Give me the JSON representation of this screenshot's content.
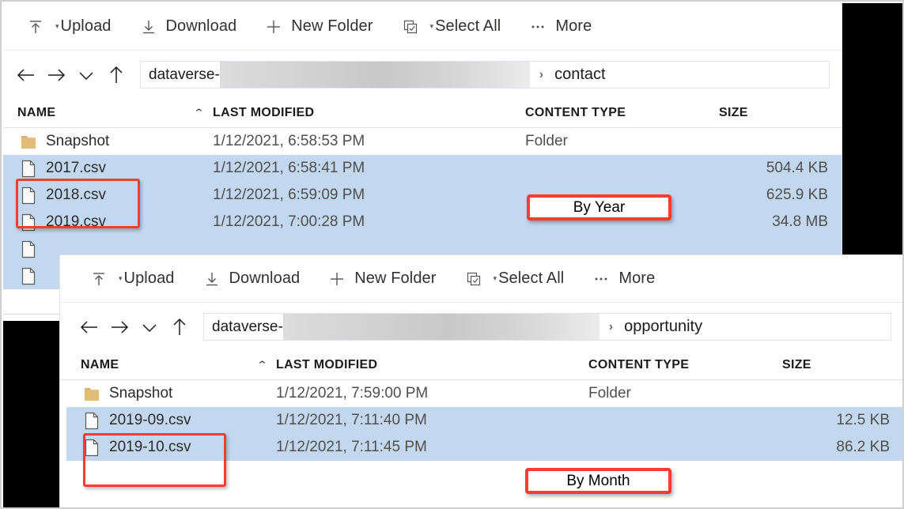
{
  "windows": [
    {
      "id": "contact",
      "toolbar": [
        {
          "label": "Upload",
          "icon": "upload-icon",
          "has_caret": true
        },
        {
          "label": "Download",
          "icon": "download-icon",
          "has_caret": false
        },
        {
          "label": "New Folder",
          "icon": "plus-icon",
          "has_caret": false
        },
        {
          "label": "Select All",
          "icon": "select-all-icon",
          "has_caret": true
        },
        {
          "label": "More",
          "icon": "ellipsis-icon",
          "has_caret": false
        }
      ],
      "nav": {
        "back_icon": "arrow-left-icon",
        "forward_icon": "arrow-right-icon",
        "history_icon": "chevron-down-icon",
        "up_icon": "arrow-up-icon"
      },
      "path": {
        "prefix": "dataverse-",
        "redacted": true,
        "separator": "›",
        "leaf": "contact"
      },
      "columns": [
        {
          "label": "NAME",
          "sorted": true,
          "sort_caret": "⌃"
        },
        {
          "label": "LAST MODIFIED",
          "sorted": false
        },
        {
          "label": "CONTENT TYPE",
          "sorted": false
        },
        {
          "label": "SIZE",
          "sorted": false
        }
      ],
      "rows": [
        {
          "name": "Snapshot",
          "icon": "folder-icon",
          "modified": "1/12/2021, 6:58:53 PM",
          "type": "Folder",
          "size": "",
          "selected": false
        },
        {
          "name": "2017.csv",
          "icon": "file-icon",
          "modified": "1/12/2021, 6:58:41 PM",
          "type": "",
          "size": "504.4 KB",
          "selected": true
        },
        {
          "name": "2018.csv",
          "icon": "file-icon",
          "modified": "1/12/2021, 6:59:09 PM",
          "type": "",
          "size": "625.9 KB",
          "selected": true
        },
        {
          "name": "2019.csv",
          "icon": "file-icon",
          "modified": "1/12/2021, 7:00:28 PM",
          "type": "",
          "size": "34.8 MB",
          "selected": true
        },
        {
          "name": "",
          "icon": "file-icon",
          "modified": "",
          "type": "",
          "size": "",
          "selected": true
        },
        {
          "name": "",
          "icon": "file-icon",
          "modified": "",
          "type": "",
          "size": "",
          "selected": true
        }
      ]
    },
    {
      "id": "opportunity",
      "toolbar": [
        {
          "label": "Upload",
          "icon": "upload-icon",
          "has_caret": true
        },
        {
          "label": "Download",
          "icon": "download-icon",
          "has_caret": false
        },
        {
          "label": "New Folder",
          "icon": "plus-icon",
          "has_caret": false
        },
        {
          "label": "Select All",
          "icon": "select-all-icon",
          "has_caret": true
        },
        {
          "label": "More",
          "icon": "ellipsis-icon",
          "has_caret": false
        }
      ],
      "nav": {
        "back_icon": "arrow-left-icon",
        "forward_icon": "arrow-right-icon",
        "history_icon": "chevron-down-icon",
        "up_icon": "arrow-up-icon"
      },
      "path": {
        "prefix": "dataverse-",
        "redacted": true,
        "separator": "›",
        "leaf": "opportunity"
      },
      "columns": [
        {
          "label": "NAME",
          "sorted": true,
          "sort_caret": "⌃"
        },
        {
          "label": "LAST MODIFIED",
          "sorted": false
        },
        {
          "label": "CONTENT TYPE",
          "sorted": false
        },
        {
          "label": "SIZE",
          "sorted": false
        }
      ],
      "rows": [
        {
          "name": "Snapshot",
          "icon": "folder-icon",
          "modified": "1/12/2021, 7:59:00 PM",
          "type": "Folder",
          "size": "",
          "selected": false
        },
        {
          "name": "2019-09.csv",
          "icon": "file-icon",
          "modified": "1/12/2021, 7:11:40 PM",
          "type": "",
          "size": "12.5 KB",
          "selected": true
        },
        {
          "name": "2019-10.csv",
          "icon": "file-icon",
          "modified": "1/12/2021, 7:11:45 PM",
          "type": "",
          "size": "86.2 KB",
          "selected": true
        }
      ]
    }
  ],
  "annotations": {
    "by_year": "By Year",
    "by_month": "By Month",
    "highlight_color": "#fa3c33"
  }
}
